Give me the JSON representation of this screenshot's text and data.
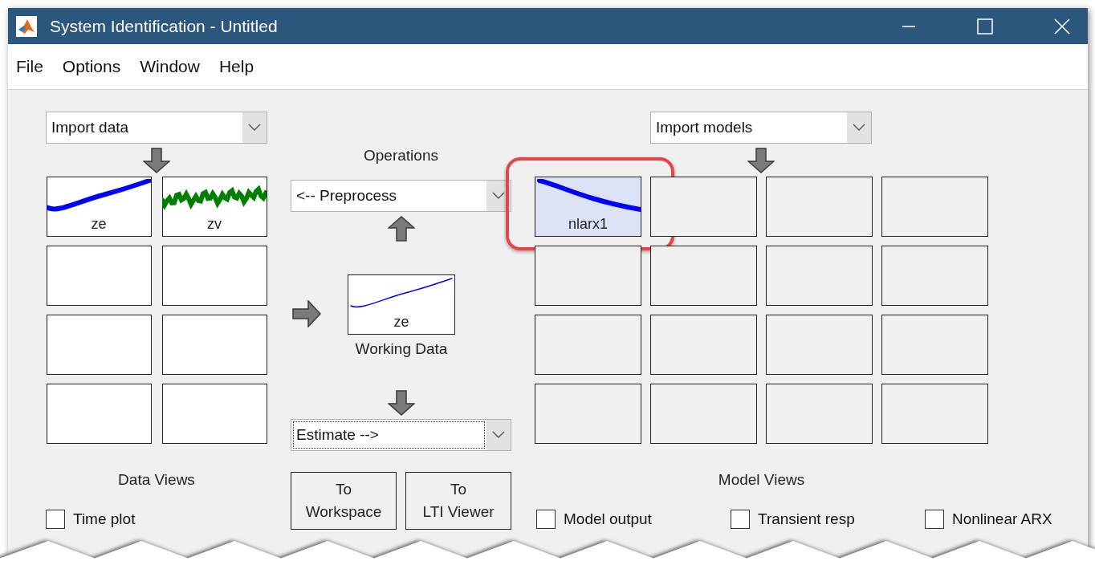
{
  "window": {
    "title": "System Identification - Untitled"
  },
  "menu": [
    {
      "label": "File"
    },
    {
      "label": "Options"
    },
    {
      "label": "Window"
    },
    {
      "label": "Help"
    }
  ],
  "data_panel": {
    "import_dropdown": {
      "value": "Import data"
    },
    "boards": [
      {
        "kind": "trend",
        "label": "ze",
        "color": "#0000ff"
      },
      {
        "kind": "noise",
        "label": "zv",
        "color": "#008000"
      },
      {
        "kind": "empty"
      },
      {
        "kind": "empty"
      },
      {
        "kind": "empty"
      },
      {
        "kind": "empty"
      },
      {
        "kind": "empty"
      },
      {
        "kind": "empty"
      }
    ],
    "views_title": "Data Views",
    "checkboxes": [
      {
        "label": "Time plot",
        "checked": false
      }
    ]
  },
  "operations": {
    "title": "Operations",
    "preprocess_dropdown": {
      "value": "<-- Preprocess"
    },
    "working_data": {
      "kind": "trend",
      "label": "ze",
      "color": "#0000ff",
      "caption": "Working Data"
    },
    "estimate_dropdown": {
      "value": "Estimate -->",
      "focused": true
    },
    "buttons": [
      {
        "label": "To\nWorkspace"
      },
      {
        "label": "To\nLTI Viewer"
      }
    ]
  },
  "model_panel": {
    "import_dropdown": {
      "value": "Import models"
    },
    "boards": [
      {
        "kind": "decay",
        "label": "nlarx1",
        "color": "#0000ff",
        "selected": true,
        "highlighted": true
      },
      {
        "kind": "empty",
        "selected": false,
        "highlighted": false
      },
      {
        "kind": "empty",
        "selected": false,
        "highlighted": false
      },
      {
        "kind": "empty",
        "selected": false,
        "highlighted": false
      },
      {
        "kind": "empty",
        "selected": false,
        "highlighted": false
      },
      {
        "kind": "empty",
        "selected": false,
        "highlighted": false
      },
      {
        "kind": "empty",
        "selected": false,
        "highlighted": false
      },
      {
        "kind": "empty",
        "selected": false,
        "highlighted": false
      },
      {
        "kind": "empty",
        "selected": false,
        "highlighted": false
      },
      {
        "kind": "empty",
        "selected": false,
        "highlighted": false
      },
      {
        "kind": "empty",
        "selected": false,
        "highlighted": false
      },
      {
        "kind": "empty",
        "selected": false,
        "highlighted": false
      },
      {
        "kind": "empty",
        "selected": false,
        "highlighted": false
      },
      {
        "kind": "empty",
        "selected": false,
        "highlighted": false
      },
      {
        "kind": "empty",
        "selected": false,
        "highlighted": false
      },
      {
        "kind": "empty",
        "selected": false,
        "highlighted": false
      }
    ],
    "views_title": "Model Views",
    "checkboxes": [
      {
        "label": "Model output",
        "checked": false
      },
      {
        "label": "Transient resp",
        "checked": false
      },
      {
        "label": "Nonlinear ARX",
        "checked": false
      }
    ]
  }
}
